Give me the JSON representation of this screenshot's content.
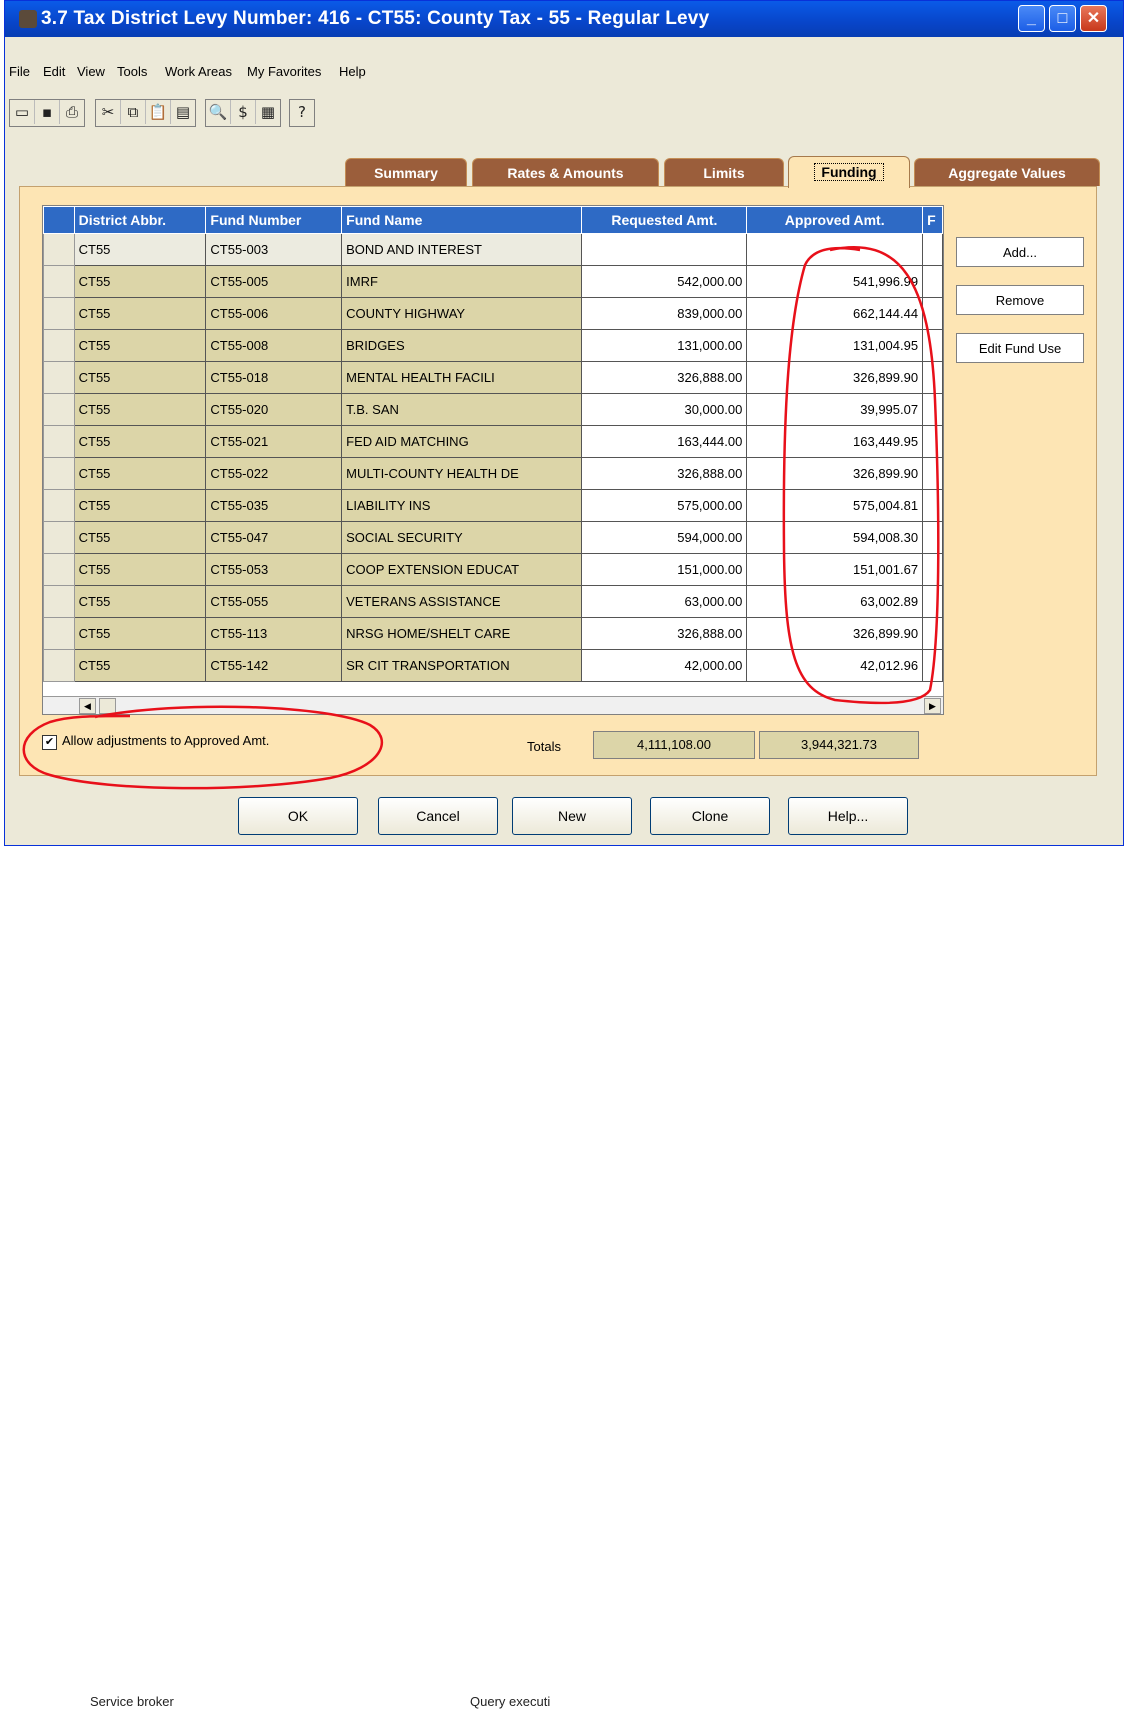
{
  "window": {
    "title": "3.7 Tax District Levy Number: 416 - CT55: County Tax - 55 - Regular Levy"
  },
  "menu": [
    "File",
    "Edit",
    "View",
    "Tools",
    "Work Areas",
    "My Favorites",
    "Help"
  ],
  "tabs": [
    {
      "label": "Summary",
      "active": false
    },
    {
      "label": "Rates & Amounts",
      "active": false
    },
    {
      "label": "Limits",
      "active": false
    },
    {
      "label": "Funding",
      "active": true
    },
    {
      "label": "Aggregate Values",
      "active": false
    }
  ],
  "grid": {
    "columns": [
      "District Abbr.",
      "Fund Number",
      "Fund Name",
      "Requested Amt.",
      "Approved Amt.",
      "F"
    ],
    "rows": [
      [
        "CT55",
        "CT55-003",
        "BOND AND INTEREST",
        "",
        ""
      ],
      [
        "CT55",
        "CT55-005",
        "IMRF",
        "542,000.00",
        "541,996.99"
      ],
      [
        "CT55",
        "CT55-006",
        "COUNTY HIGHWAY",
        "839,000.00",
        "662,144.44"
      ],
      [
        "CT55",
        "CT55-008",
        "BRIDGES",
        "131,000.00",
        "131,004.95"
      ],
      [
        "CT55",
        "CT55-018",
        "MENTAL HEALTH FACILI",
        "326,888.00",
        "326,899.90"
      ],
      [
        "CT55",
        "CT55-020",
        "T.B. SAN",
        "30,000.00",
        "39,995.07"
      ],
      [
        "CT55",
        "CT55-021",
        "FED AID MATCHING",
        "163,444.00",
        "163,449.95"
      ],
      [
        "CT55",
        "CT55-022",
        "MULTI-COUNTY HEALTH DE",
        "326,888.00",
        "326,899.90"
      ],
      [
        "CT55",
        "CT55-035",
        "LIABILITY INS",
        "575,000.00",
        "575,004.81"
      ],
      [
        "CT55",
        "CT55-047",
        "SOCIAL SECURITY",
        "594,000.00",
        "594,008.30"
      ],
      [
        "CT55",
        "CT55-053",
        "COOP EXTENSION EDUCAT",
        "151,000.00",
        "151,001.67"
      ],
      [
        "CT55",
        "CT55-055",
        "VETERANS ASSISTANCE",
        "63,000.00",
        "63,002.89"
      ],
      [
        "CT55",
        "CT55-113",
        "NRSG HOME/SHELT CARE",
        "326,888.00",
        "326,899.90"
      ],
      [
        "CT55",
        "CT55-142",
        "SR CIT TRANSPORTATION",
        "42,000.00",
        "42,012.96"
      ]
    ]
  },
  "side_buttons": [
    "Add...",
    "Remove",
    "Edit Fund Use"
  ],
  "checkbox": {
    "label": "Allow adjustments to Approved Amt.",
    "checked": true
  },
  "totals": {
    "label": "Totals",
    "requested": "4,111,108.00",
    "approved": "3,944,321.73"
  },
  "buttons": [
    "OK",
    "Cancel",
    "New",
    "Clone",
    "Help..."
  ],
  "background": {
    "left_text": "Service broker",
    "right_text": "Query executi"
  },
  "colors": {
    "title_bar": "#0845c9",
    "grid_header": "#2e6ac5",
    "panel": "#fde5b4",
    "tab_inactive": "#9b5e3b",
    "annotation": "#e8101a"
  }
}
